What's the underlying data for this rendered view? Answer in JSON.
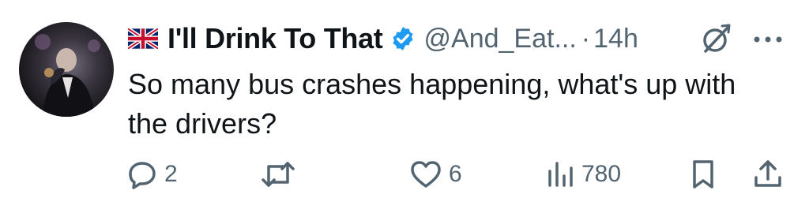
{
  "author": {
    "display_name": "I'll Drink To That",
    "handle": "@And_Eat...",
    "separator": "·",
    "time": "14h"
  },
  "tweet": {
    "text": "So many bus crashes happening, what's up with the drivers?"
  },
  "actions": {
    "reply_count": "2",
    "like_count": "6",
    "views_count": "780"
  },
  "icons": {
    "flag": "uk-flag-icon",
    "verified": "verified-badge-icon",
    "grok": "grok-icon",
    "more": "more-icon",
    "reply": "reply-icon",
    "retweet": "retweet-icon",
    "like": "heart-icon",
    "views": "views-icon",
    "bookmark": "bookmark-icon",
    "share": "share-icon"
  },
  "colors": {
    "text": "#0f1419",
    "secondary": "#536471",
    "verified": "#1d9bf0"
  }
}
